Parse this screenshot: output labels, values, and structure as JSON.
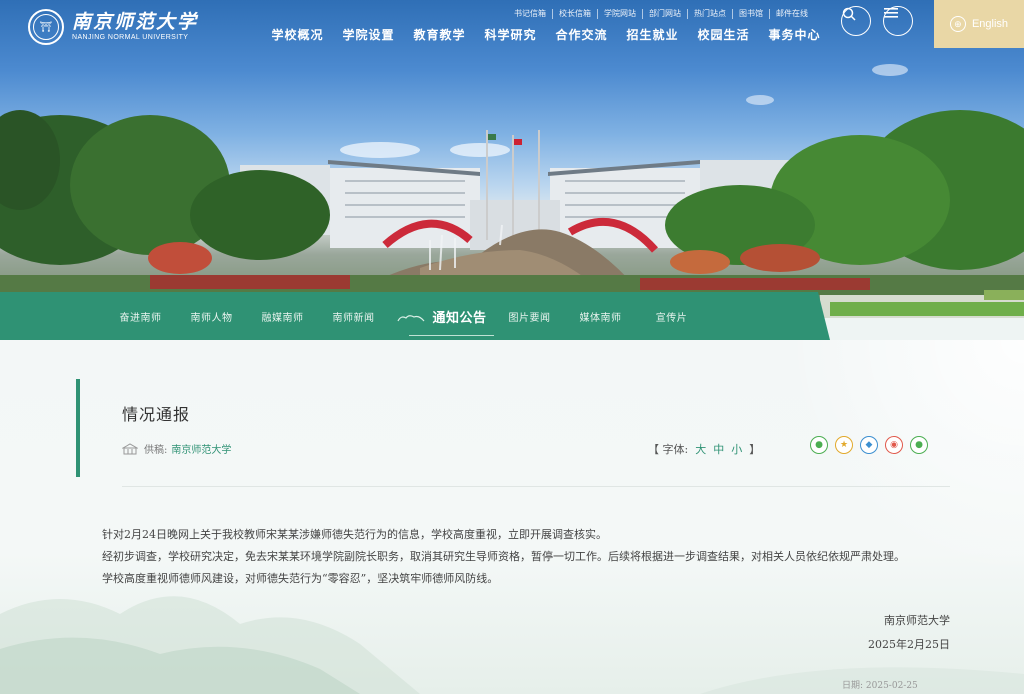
{
  "header": {
    "logo_cn": "南京师范大学",
    "logo_en": "NANJING NORMAL UNIVERSITY",
    "top_links": [
      "书记信箱",
      "校长信箱",
      "学院网站",
      "部门网站",
      "热门站点",
      "图书馆",
      "邮件在线"
    ],
    "main_nav": [
      "学校概况",
      "学院设置",
      "教育教学",
      "科学研究",
      "合作交流",
      "招生就业",
      "校园生活",
      "事务中心"
    ],
    "search_icon": "search-icon",
    "menu_icon": "menu-icon",
    "lang_label": "English"
  },
  "subnav": {
    "items": [
      "奋进南师",
      "南师人物",
      "融媒南师",
      "南师新闻",
      "通知公告",
      "图片要闻",
      "媒体南师",
      "宣传片"
    ],
    "active": "通知公告"
  },
  "article": {
    "title": "情况通报",
    "source_label": "供稿:",
    "source": "南京师范大学",
    "font_label": "【 字体:",
    "font_sizes": [
      "大",
      "中",
      "小"
    ],
    "font_end": "】",
    "share_icons": [
      "wechat-icon",
      "qzone-icon",
      "qq-icon",
      "weibo-icon",
      "wechat-moments-icon"
    ],
    "paragraphs": [
      "针对2月24日晚网上关于我校教师宋某某涉嫌师德失范行为的信息，学校高度重视，立即开展调查核实。",
      "经初步调查，学校研究决定，免去宋某某环境学院副院长职务，取消其研究生导师资格，暂停一切工作。后续将根据进一步调查结果，对相关人员依纪依规严肃处理。",
      "学校高度重视师德师风建设，对师德失范行为“零容忍”，坚决筑牢师德师风防线。"
    ],
    "signature": "南京师范大学",
    "sign_date": "2025年2月25日",
    "footer_date": "日期: 2025-02-25"
  },
  "colors": {
    "primary_green": "#2f9274",
    "lang_gold": "#e9d7a6"
  }
}
